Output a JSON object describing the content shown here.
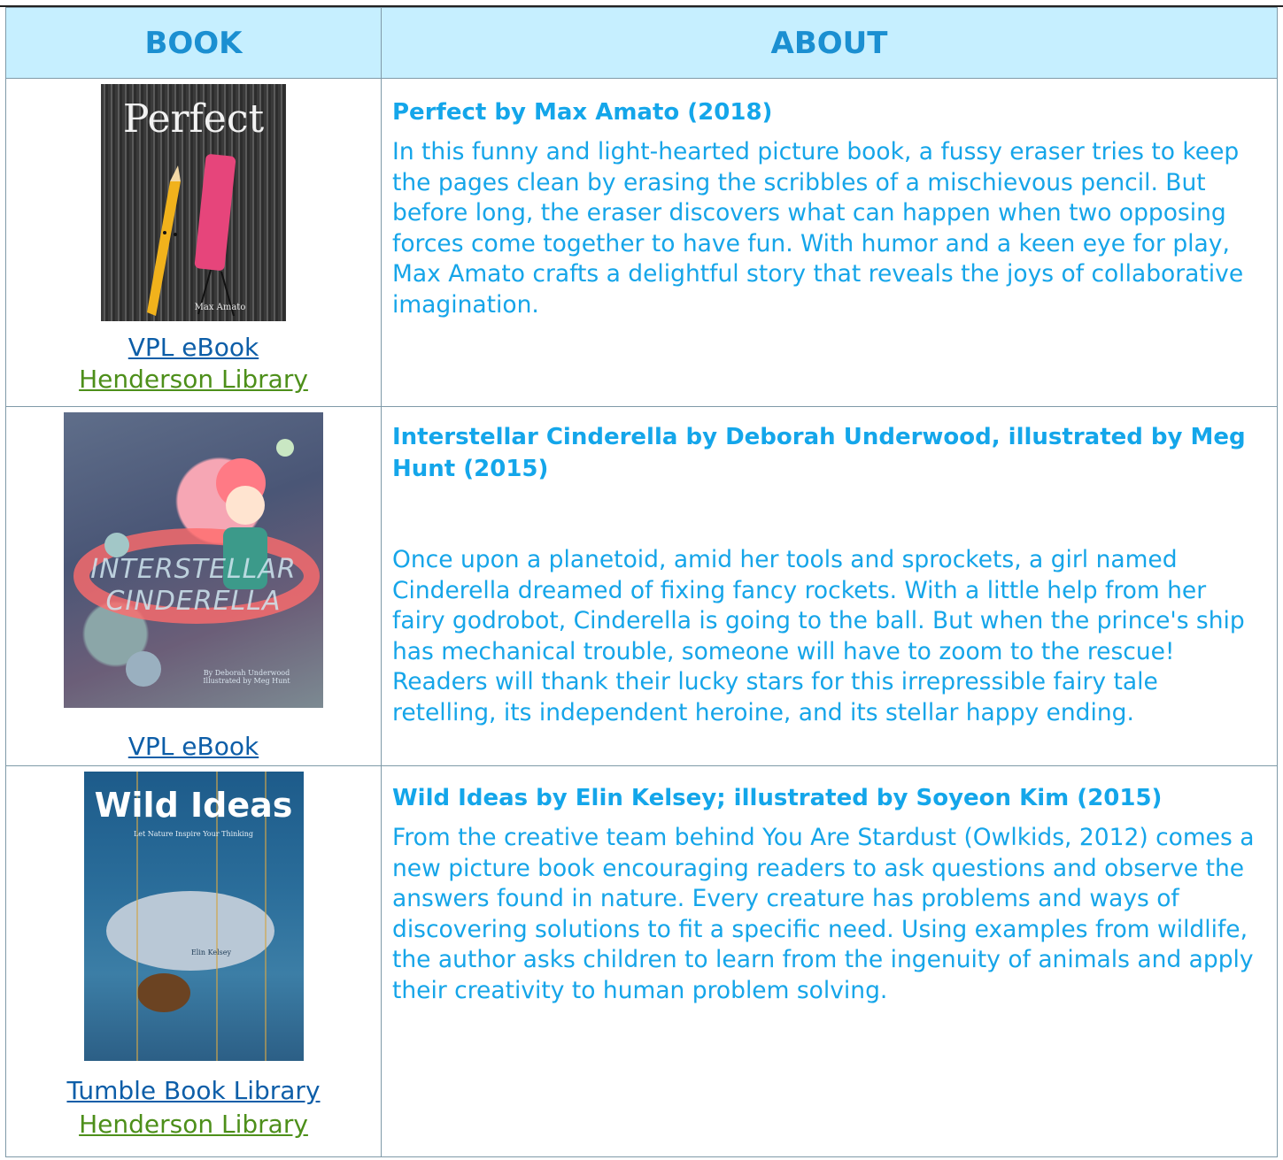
{
  "header": {
    "col_book": "BOOK",
    "col_about": "ABOUT"
  },
  "rows": [
    {
      "cover": {
        "title": "Perfect",
        "author": "Max Amato"
      },
      "links": [
        "VPL eBook",
        "Henderson Library"
      ],
      "title": "Perfect by Max Amato (2018)",
      "description": "In this funny and light-hearted picture book, a fussy eraser tries to keep the pages clean by erasing the scribbles of a mischievous pencil. But before long, the eraser discovers what can happen when two opposing forces come together to have fun. With humor and a keen eye for play, Max Amato crafts a delightful story that reveals the joys of collaborative imagination."
    },
    {
      "cover": {
        "title": "INTERSTELLAR CINDERELLA",
        "author": "By Deborah Underwood Illustrated by Meg Hunt"
      },
      "links": [
        "VPL eBook"
      ],
      "title": "Interstellar Cinderella by Deborah Underwood, illustrated by Meg Hunt (2015)",
      "description": "Once upon a planetoid, amid her tools and sprockets, a girl named Cinderella dreamed of fixing fancy rockets. With a little help from her fairy godrobot, Cinderella is going to the ball. But when the prince's ship has mechanical trouble, someone will have to zoom to the rescue! Readers will thank their lucky stars for this irrepressible fairy tale retelling, its independent heroine, and its stellar happy ending."
    },
    {
      "cover": {
        "title": "Wild Ideas",
        "subtitle": "Let Nature Inspire Your Thinking",
        "author": "Elin Kelsey"
      },
      "links": [
        "Tumble Book Library",
        "Henderson Library"
      ],
      "title": "Wild Ideas by Elin Kelsey; illustrated by Soyeon Kim (2015)",
      "description": "From the creative team behind You Are Stardust (Owlkids, 2012) comes a new picture book encouraging readers to ask questions and observe the answers found in nature. Every creature has problems and ways of discovering solutions to fit a specific need. Using examples from wildlife, the author asks children to learn from the ingenuity of animals and apply their creativity to human problem solving."
    }
  ]
}
